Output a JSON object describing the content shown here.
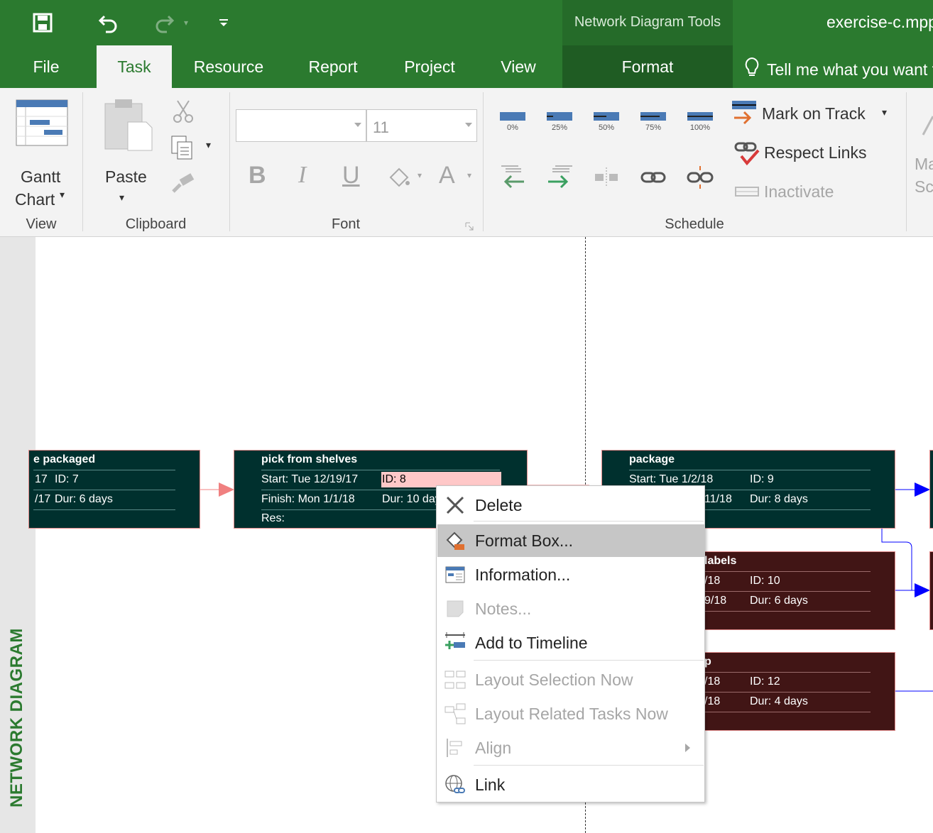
{
  "window": {
    "document_title": "exercise-c.mpp",
    "contextual_title": "Network Diagram Tools"
  },
  "tabs": [
    {
      "label": "File"
    },
    {
      "label": "Task"
    },
    {
      "label": "Resource"
    },
    {
      "label": "Report"
    },
    {
      "label": "Project"
    },
    {
      "label": "View"
    },
    {
      "label": "Format"
    }
  ],
  "tell_me": "Tell me what you want to do",
  "ribbon": {
    "view": {
      "gantt_line1": "Gantt",
      "gantt_line2": "Chart",
      "label": "View"
    },
    "clipboard": {
      "paste": "Paste",
      "label": "Clipboard"
    },
    "font": {
      "font_name": "",
      "font_size": "11",
      "bold": "B",
      "italic": "I",
      "underline": "U",
      "font_color": "A",
      "label": "Font"
    },
    "schedule": {
      "pct_labels": [
        "0%",
        "25%",
        "50%",
        "75%",
        "100%"
      ],
      "mark_on_track": "Mark on Track",
      "respect_links": "Respect Links",
      "inactivate": "Inactivate",
      "label": "Schedule"
    },
    "partial": {
      "line1": "Ma",
      "line2": "Sc"
    }
  },
  "side_label": "NETWORK DIAGRAM",
  "tasks": [
    {
      "name": "e packaged",
      "row1_left": "17",
      "row1_id": "ID:  7",
      "row2_left": "/17",
      "row2_dur": "Dur: 6 days"
    },
    {
      "name": "pick from shelves",
      "start": "Start:  Tue 12/19/17",
      "id": "ID:  8",
      "finish": "Finish: Mon 1/1/18",
      "dur": "Dur: 10 days",
      "res": "Res:"
    },
    {
      "name": "package",
      "start": "Start:  Tue 1/2/18",
      "id": "ID:  9",
      "finish_tail": "11/18",
      "dur": "Dur: 8 days"
    },
    {
      "name": "labels",
      "start_tail": "/18",
      "id": "ID:  10",
      "finish_tail": "9/18",
      "dur": "Dur: 6 days"
    },
    {
      "name": "p",
      "start_tail": "/18",
      "id": "ID:  12",
      "finish_tail": "/18",
      "dur": "Dur: 4 days"
    }
  ],
  "context_menu": {
    "items": [
      {
        "label": "Delete",
        "icon": "delete-x-icon",
        "enabled": true
      },
      {
        "label": "Format Box...",
        "icon": "format-box-icon",
        "enabled": true,
        "highlighted": true
      },
      {
        "label": "Information...",
        "icon": "information-icon",
        "enabled": true
      },
      {
        "label": "Notes...",
        "icon": "notes-icon",
        "enabled": false
      },
      {
        "label": "Add to Timeline",
        "icon": "add-to-timeline-icon",
        "enabled": true
      },
      {
        "label": "Layout Selection Now",
        "icon": "layout-selection-icon",
        "enabled": false
      },
      {
        "label": "Layout Related Tasks Now",
        "icon": "layout-related-icon",
        "enabled": false
      },
      {
        "label": "Align",
        "icon": "align-icon",
        "enabled": false
      },
      {
        "label": "Link",
        "icon": "link-globe-icon",
        "enabled": true
      }
    ]
  },
  "colors": {
    "brand_green": "#2b7a2f",
    "task_teal": "#00302e",
    "task_maroon": "#411515",
    "link_arrow_blue": "#0000ff",
    "link_arrow_red": "#f08080"
  }
}
